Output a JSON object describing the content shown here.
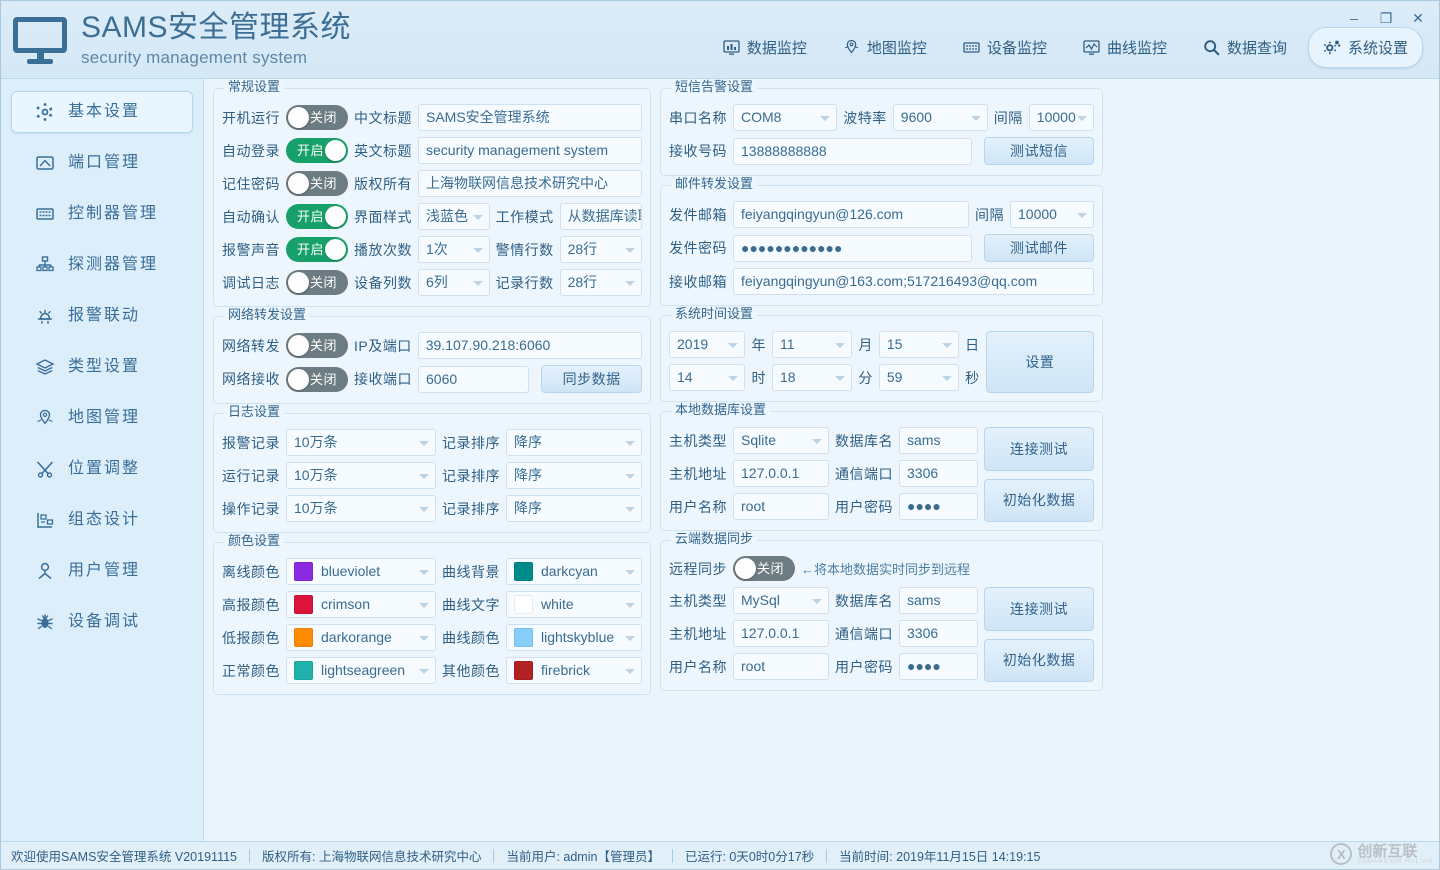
{
  "window": {
    "title_cn": "SAMS安全管理系统",
    "title_en": "security management system",
    "minimize": "–",
    "maximize": "❐",
    "close": "✕"
  },
  "topnav": [
    {
      "label": "数据监控",
      "icon": "data-monitor-icon",
      "active": false
    },
    {
      "label": "地图监控",
      "icon": "map-monitor-icon",
      "active": false
    },
    {
      "label": "设备监控",
      "icon": "device-monitor-icon",
      "active": false
    },
    {
      "label": "曲线监控",
      "icon": "curve-monitor-icon",
      "active": false
    },
    {
      "label": "数据查询",
      "icon": "search-icon",
      "active": false
    },
    {
      "label": "系统设置",
      "icon": "gear-icon",
      "active": true
    }
  ],
  "sidebar": [
    {
      "label": "基本设置",
      "icon": "gear-icon",
      "active": true
    },
    {
      "label": "端口管理",
      "icon": "port-icon",
      "active": false
    },
    {
      "label": "控制器管理",
      "icon": "controller-icon",
      "active": false
    },
    {
      "label": "探测器管理",
      "icon": "detector-icon",
      "active": false
    },
    {
      "label": "报警联动",
      "icon": "alarm-icon",
      "active": false
    },
    {
      "label": "类型设置",
      "icon": "layers-icon",
      "active": false
    },
    {
      "label": "地图管理",
      "icon": "map-pin-icon",
      "active": false
    },
    {
      "label": "位置调整",
      "icon": "tools-icon",
      "active": false
    },
    {
      "label": "组态设计",
      "icon": "design-icon",
      "active": false
    },
    {
      "label": "用户管理",
      "icon": "user-icon",
      "active": false
    },
    {
      "label": "设备调试",
      "icon": "bug-icon",
      "active": false
    }
  ],
  "general": {
    "legend": "常规设置",
    "rows": [
      {
        "label": "开机运行",
        "toggle": "关闭",
        "state": "off",
        "field_label": "中文标题",
        "value": "SAMS安全管理系统"
      },
      {
        "label": "自动登录",
        "toggle": "开启",
        "state": "on",
        "field_label": "英文标题",
        "value": "security management system"
      },
      {
        "label": "记住密码",
        "toggle": "关闭",
        "state": "off",
        "field_label": "版权所有",
        "value": "上海物联网信息技术研究中心"
      }
    ],
    "row4": {
      "label": "自动确认",
      "toggle": "开启",
      "state": "on",
      "f1_label": "界面样式",
      "f1_value": "浅蓝色",
      "f2_label": "工作模式",
      "f2_value": "从数据库读取"
    },
    "row5": {
      "label": "报警声音",
      "toggle": "开启",
      "state": "on",
      "f1_label": "播放次数",
      "f1_value": "1次",
      "f2_label": "警情行数",
      "f2_value": "28行"
    },
    "row6": {
      "label": "调试日志",
      "toggle": "关闭",
      "state": "off",
      "f1_label": "设备列数",
      "f1_value": "6列",
      "f2_label": "记录行数",
      "f2_value": "28行"
    }
  },
  "sms": {
    "legend": "短信告警设置",
    "port_label": "串口名称",
    "port_value": "COM8",
    "baud_label": "波特率",
    "baud_value": "9600",
    "interval_label": "间隔",
    "interval_value": "10000",
    "number_label": "接收号码",
    "number_value": "13888888888",
    "test_button": "测试短信"
  },
  "mail": {
    "legend": "邮件转发设置",
    "sender_label": "发件邮箱",
    "sender_value": "feiyangqingyun@126.com",
    "interval_label": "间隔",
    "interval_value": "10000",
    "password_label": "发件密码",
    "password_value": "●●●●●●●●●●●●",
    "test_button": "测试邮件",
    "receiver_label": "接收邮箱",
    "receiver_value": "feiyangqingyun@163.com;517216493@qq.com"
  },
  "netfwd": {
    "legend": "网络转发设置",
    "fwd_label": "网络转发",
    "fwd_toggle": "关闭",
    "fwd_state": "off",
    "ip_label": "IP及端口",
    "ip_value": "39.107.90.218:6060",
    "recv_label": "网络接收",
    "recv_toggle": "关闭",
    "recv_state": "off",
    "recv_port_label": "接收端口",
    "recv_port_value": "6060",
    "sync_button": "同步数据"
  },
  "systime": {
    "legend": "系统时间设置",
    "year": "2019",
    "year_unit": "年",
    "month": "11",
    "month_unit": "月",
    "day": "15",
    "day_unit": "日",
    "hour": "14",
    "hour_unit": "时",
    "minute": "18",
    "minute_unit": "分",
    "second": "59",
    "second_unit": "秒",
    "set_button": "设置"
  },
  "log": {
    "legend": "日志设置",
    "rows": [
      {
        "label": "报警记录",
        "value": "10万条",
        "sort_label": "记录排序",
        "sort_value": "降序"
      },
      {
        "label": "运行记录",
        "value": "10万条",
        "sort_label": "记录排序",
        "sort_value": "降序"
      },
      {
        "label": "操作记录",
        "value": "10万条",
        "sort_label": "记录排序",
        "sort_value": "降序"
      }
    ]
  },
  "localdb": {
    "legend": "本地数据库设置",
    "type_label": "主机类型",
    "type_value": "Sqlite",
    "name_label": "数据库名",
    "name_value": "sams",
    "addr_label": "主机地址",
    "addr_value": "127.0.0.1",
    "port_label": "通信端口",
    "port_value": "3306",
    "user_label": "用户名称",
    "user_value": "root",
    "pwd_label": "用户密码",
    "pwd_value": "●●●●",
    "test_button": "连接测试",
    "init_button": "初始化数据"
  },
  "colors": {
    "legend": "颜色设置",
    "rows": [
      {
        "l1": "离线颜色",
        "v1": "blueviolet",
        "c1": "#8a2be2",
        "l2": "曲线背景",
        "v2": "darkcyan",
        "c2": "#008b8b"
      },
      {
        "l1": "高报颜色",
        "v1": "crimson",
        "c1": "#dc143c",
        "l2": "曲线文字",
        "v2": "white",
        "c2": "#ffffff"
      },
      {
        "l1": "低报颜色",
        "v1": "darkorange",
        "c1": "#ff8c00",
        "l2": "曲线颜色",
        "v2": "lightskyblue",
        "c2": "#87cefa"
      },
      {
        "l1": "正常颜色",
        "v1": "lightseagreen",
        "c1": "#20b2aa",
        "l2": "其他颜色",
        "v2": "firebrick",
        "c2": "#b22222"
      }
    ]
  },
  "clouddb": {
    "legend": "云端数据同步",
    "sync_label": "远程同步",
    "sync_toggle": "关闭",
    "sync_state": "off",
    "hint": "←将本地数据实时同步到远程",
    "type_label": "主机类型",
    "type_value": "MySql",
    "name_label": "数据库名",
    "name_value": "sams",
    "addr_label": "主机地址",
    "addr_value": "127.0.0.1",
    "port_label": "通信端口",
    "port_value": "3306",
    "user_label": "用户名称",
    "user_value": "root",
    "pwd_label": "用户密码",
    "pwd_value": "●●●●",
    "test_button": "连接测试",
    "init_button": "初始化数据"
  },
  "statusbar": {
    "welcome": "欢迎使用SAMS安全管理系统 V20191115",
    "copyright": "版权所有: 上海物联网信息技术研究中心",
    "user": "当前用户: admin【管理员】",
    "uptime": "已运行: 0天0时0分17秒",
    "time": "当前时间: 2019年11月15日 14:19:15",
    "watermark": "创新互联",
    "watermark_sub": "CHUANGXIN HULIAN"
  }
}
